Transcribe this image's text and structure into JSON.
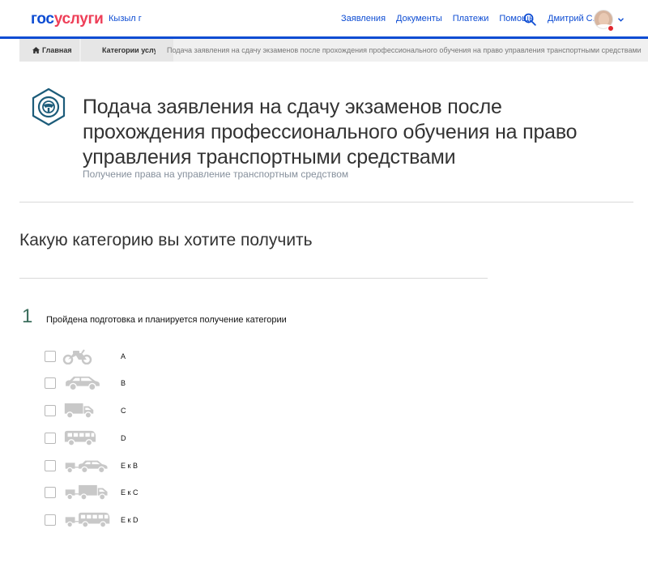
{
  "header": {
    "logo_part1": "гос",
    "logo_part2": "услуги",
    "region": "Кызыл г",
    "nav": [
      "Заявления",
      "Документы",
      "Платежи",
      "Помощь"
    ],
    "user_name": "Дмитрий С."
  },
  "breadcrumb": {
    "home": "Главная",
    "category": "Категории услуг",
    "current": "Подача заявления на сдачу экзаменов после прохождения профессионального обучения на право управления транспортными средствами"
  },
  "service": {
    "title": "Подача заявления на сдачу экзаменов после прохождения профессионального обучения на право управления транспортными средствами",
    "subtitle": "Получение права на управление транспортным средством"
  },
  "question": "Какую категорию вы хотите получить",
  "step": {
    "number": "1",
    "text": "Пройдена подготовка и планируется получение категории"
  },
  "options": [
    {
      "label": "A",
      "icon": "motorcycle-icon",
      "checked": false
    },
    {
      "label": "B",
      "icon": "car-icon",
      "checked": false
    },
    {
      "label": "C",
      "icon": "truck-icon",
      "checked": false
    },
    {
      "label": "D",
      "icon": "bus-icon",
      "checked": false
    },
    {
      "label": "Е к B",
      "icon": "car-trailer-icon",
      "checked": false
    },
    {
      "label": "Е к C",
      "icon": "truck-trailer-icon",
      "checked": false
    },
    {
      "label": "Е к D",
      "icon": "bus-trailer-icon",
      "checked": false
    }
  ],
  "colors": {
    "brand_blue": "#0d4cd3",
    "brand_red": "#ee3f58",
    "icon_teal": "#1c5c7a",
    "vehicle_gray": "#c8c8c8"
  }
}
